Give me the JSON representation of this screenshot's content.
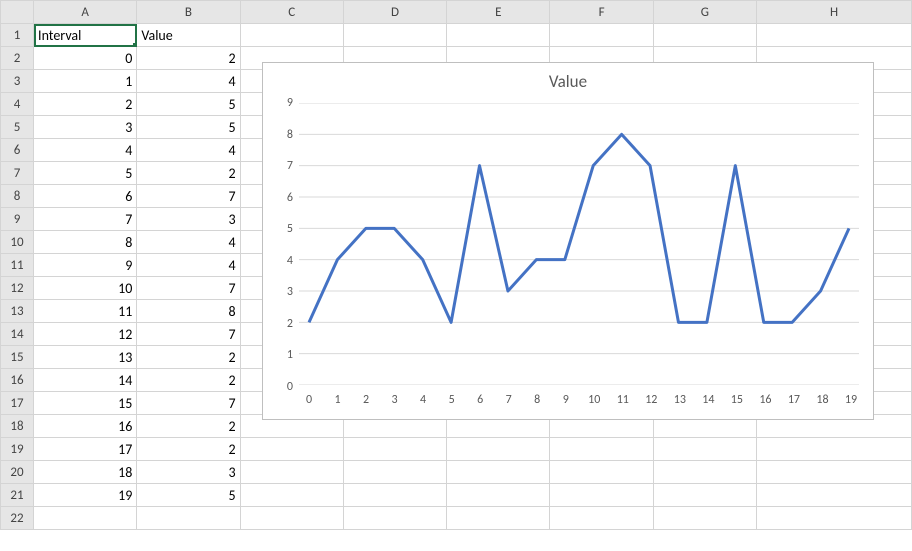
{
  "columns": [
    "A",
    "B",
    "C",
    "D",
    "E",
    "F",
    "G",
    "H"
  ],
  "row_count": 22,
  "selected_cell": "A1",
  "headers": {
    "A1": "Interval",
    "B1": "Value"
  },
  "table": {
    "interval": [
      0,
      1,
      2,
      3,
      4,
      5,
      6,
      7,
      8,
      9,
      10,
      11,
      12,
      13,
      14,
      15,
      16,
      17,
      18,
      19
    ],
    "value": [
      2,
      4,
      5,
      5,
      4,
      2,
      7,
      3,
      4,
      4,
      7,
      8,
      7,
      2,
      2,
      7,
      2,
      2,
      3,
      5
    ]
  },
  "chart_data": {
    "type": "line",
    "title": "Value",
    "x": [
      0,
      1,
      2,
      3,
      4,
      5,
      6,
      7,
      8,
      9,
      10,
      11,
      12,
      13,
      14,
      15,
      16,
      17,
      18,
      19
    ],
    "series": [
      {
        "name": "Value",
        "values": [
          2,
          4,
          5,
          5,
          4,
          2,
          7,
          3,
          4,
          4,
          7,
          8,
          7,
          2,
          2,
          7,
          2,
          2,
          3,
          5
        ],
        "color": "#4472C4"
      }
    ],
    "xlabel": "",
    "ylabel": "",
    "ylim": [
      0,
      9
    ],
    "ytick_step": 1,
    "grid": true
  }
}
